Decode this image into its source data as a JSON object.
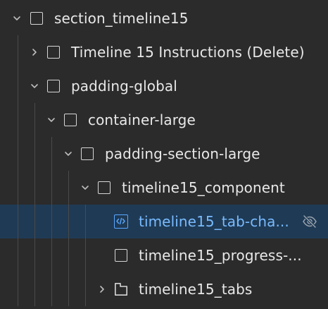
{
  "tree": {
    "rows": [
      {
        "label": "section_timeline15",
        "icon": "element-box-icon",
        "state": "expanded"
      },
      {
        "label": "Timeline 15 Instructions (Delete)",
        "icon": "element-box-icon",
        "state": "collapsed"
      },
      {
        "label": "padding-global",
        "icon": "element-box-icon",
        "state": "expanded"
      },
      {
        "label": "container-large",
        "icon": "element-box-icon",
        "state": "expanded"
      },
      {
        "label": "padding-section-large",
        "icon": "element-box-icon",
        "state": "expanded"
      },
      {
        "label": "timeline15_component",
        "icon": "element-box-icon",
        "state": "expanded"
      },
      {
        "label": "timeline15_tab-cha...",
        "icon": "code-embed-icon",
        "state": "leaf",
        "selected": true,
        "hidden_indicator": "eye-slash-icon"
      },
      {
        "label": "timeline15_progress-...",
        "icon": "element-box-icon",
        "state": "leaf"
      },
      {
        "label": "timeline15_tabs",
        "icon": "tabs-component-icon",
        "state": "collapsed"
      }
    ]
  },
  "colors": {
    "background": "#2b2b2b",
    "selected_row": "#1f3a55",
    "selected_text": "#78bbff",
    "text": "#e8e8e8",
    "guide_line": "#4a4a4a"
  }
}
